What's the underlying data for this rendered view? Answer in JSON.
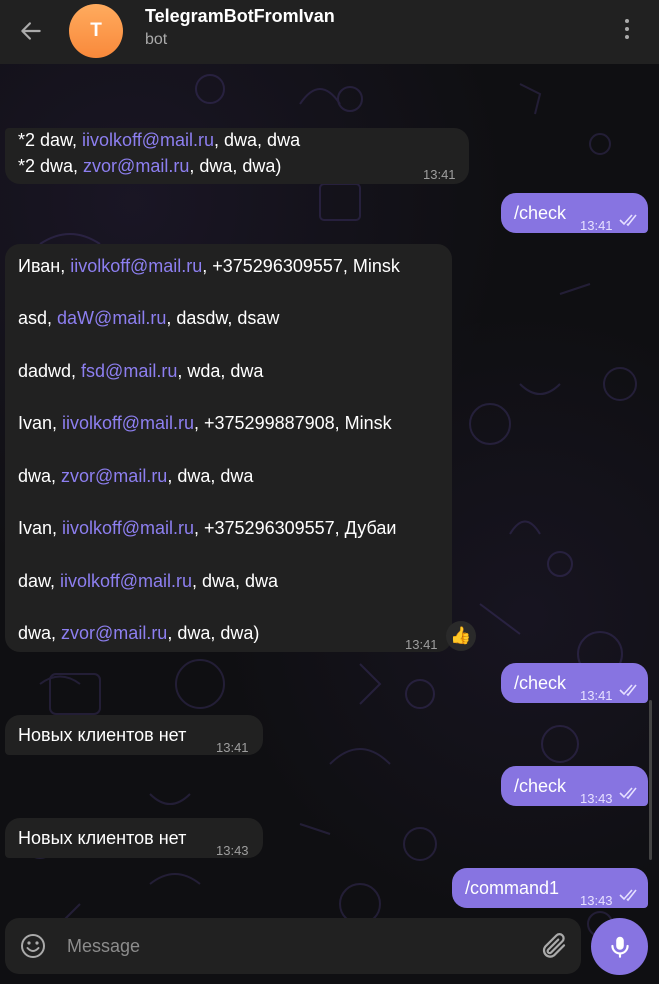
{
  "header": {
    "back_icon": "arrow-left-icon",
    "avatar_letter": "T",
    "title": "TelegramBotFromIvan",
    "subtitle": "bot",
    "menu_icon": "more-vertical-icon"
  },
  "messages": {
    "m1": {
      "direction": "incoming",
      "l1_a": "*2 daw, ",
      "l1_link": "iivolkoff@mail.ru",
      "l1_b": ", dwa, dwa",
      "l2_a": "*2 dwa, ",
      "l2_link": "zvor@mail.ru",
      "l2_b": ", dwa, dwa)",
      "time": "13:41"
    },
    "m2": {
      "direction": "outgoing",
      "text": "/check",
      "time": "13:41"
    },
    "m3": {
      "direction": "incoming",
      "rows": [
        {
          "a": "Иван, ",
          "link": "iivolkoff@mail.ru",
          "b": ", +375296309557, Minsk"
        },
        {
          "a": " asd, ",
          "link": "daW@mail.ru",
          "b": ", dasdw, dsaw"
        },
        {
          "a": " dadwd, ",
          "link": "fsd@mail.ru",
          "b": ", wda, dwa"
        },
        {
          "a": " Ivan, ",
          "link": "iivolkoff@mail.ru",
          "b": ", +375299887908, Minsk"
        },
        {
          "a": " dwa, ",
          "link": "zvor@mail.ru",
          "b": ", dwa, dwa"
        },
        {
          "a": " Ivan, ",
          "link": "iivolkoff@mail.ru",
          "b": ", +375296309557, Дубаи"
        },
        {
          "a": " daw, ",
          "link": "iivolkoff@mail.ru",
          "b": ", dwa, dwa"
        },
        {
          "a": " dwa, ",
          "link": "zvor@mail.ru",
          "b": ", dwa, dwa)"
        }
      ],
      "time": "13:41",
      "reaction": "👍"
    },
    "m4": {
      "direction": "outgoing",
      "text": "/check",
      "time": "13:41"
    },
    "m5": {
      "direction": "incoming",
      "text": "Новых клиентов нет",
      "time": "13:41"
    },
    "m6": {
      "direction": "outgoing",
      "text": "/check",
      "time": "13:43"
    },
    "m7": {
      "direction": "incoming",
      "text": "Новых клиентов нет",
      "time": "13:43"
    },
    "m8": {
      "direction": "outgoing",
      "text": "/command1",
      "time": "13:43"
    }
  },
  "composer": {
    "placeholder": "Message",
    "emoji_icon": "smiley-icon",
    "attach_icon": "paperclip-icon",
    "mic_icon": "microphone-icon"
  },
  "colors": {
    "header_bg": "#212121",
    "incoming_bubble": "#212121",
    "outgoing_bubble": "#8774e1",
    "link": "#8d7ff0",
    "avatar": "#f9893b",
    "accent": "#8774e1"
  }
}
